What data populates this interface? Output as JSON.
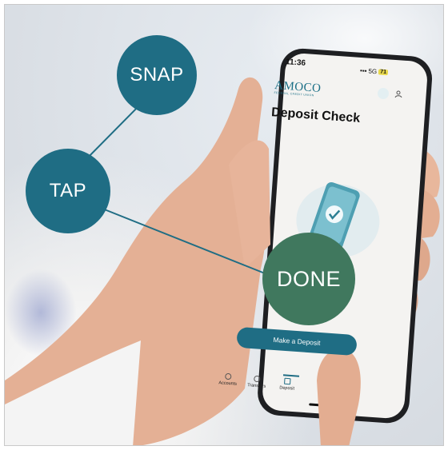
{
  "steps": {
    "snap": "SNAP",
    "tap": "TAP",
    "done": "DONE"
  },
  "status_bar": {
    "time": "11:36",
    "network": "5G",
    "battery": "71"
  },
  "brand": {
    "logo": "AMOCO",
    "tagline": "FEDERAL CREDIT UNION"
  },
  "screen": {
    "title": "Deposit Check",
    "cta_label": "Make a Deposit"
  },
  "bottom_nav": {
    "items": [
      {
        "label": "Accounts",
        "icon": "accounts-icon"
      },
      {
        "label": "Transfers",
        "icon": "transfers-icon"
      },
      {
        "label": "Deposit",
        "icon": "deposit-icon",
        "active": true
      }
    ]
  },
  "colors": {
    "teal": "#1f6d84",
    "green": "#40785e"
  }
}
